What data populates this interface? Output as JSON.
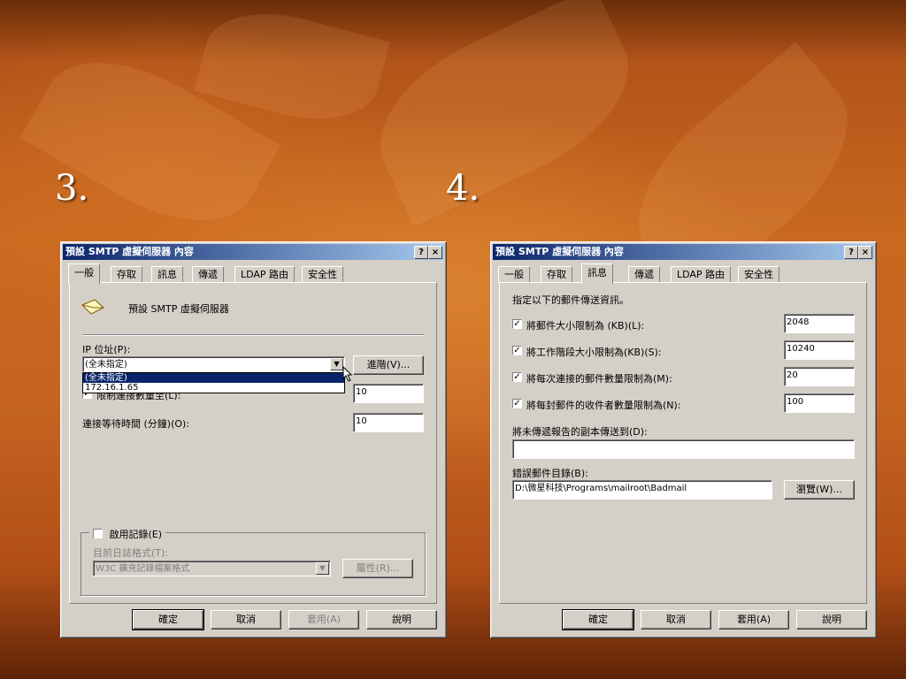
{
  "slide": {
    "num_left": "3.",
    "num_right": "4."
  },
  "common": {
    "title": "預設 SMTP 虛擬伺服器 內容",
    "help_glyph": "?",
    "close_glyph": "×",
    "tabs": [
      "一般",
      "存取",
      "訊息",
      "傳遞",
      "LDAP 路由",
      "安全性"
    ],
    "buttons": {
      "ok": "確定",
      "cancel": "取消",
      "apply": "套用(A)",
      "help": "說明"
    }
  },
  "left": {
    "server_name": "預設 SMTP 虛擬伺服器",
    "ip_label": "IP 位址(P):",
    "ip_selected": "(全未指定)",
    "ip_options": [
      "(全未指定)",
      "172.16.1.65"
    ],
    "advanced_button": "進階(V)...",
    "limit_label": "限制連接數量至(L):",
    "limit_value": "10",
    "timeout_label": "連接等待時間 (分鐘)(O):",
    "timeout_value": "10",
    "logging_label": "啟用記錄(E)",
    "log_format_label": "目前日誌格式(T):",
    "log_format_value": "W3C 擴充記錄檔案格式",
    "properties_button": "屬性(R)..."
  },
  "right": {
    "intro": "指定以下的郵件傳送資訊。",
    "limits": [
      {
        "label": "將郵件大小限制為 (KB)(L):",
        "value": "2048"
      },
      {
        "label": "將工作階段大小限制為(KB)(S):",
        "value": "10240"
      },
      {
        "label": "將每次連接的郵件數量限制為(M):",
        "value": "20"
      },
      {
        "label": "將每封郵件的收件者數量限制為(N):",
        "value": "100"
      }
    ],
    "ndr_label": "將未傳遞報告的副本傳送到(D):",
    "ndr_value": "",
    "badmail_label": "錯誤郵件目錄(B):",
    "badmail_value": "D:\\微星科技\\Programs\\mailroot\\Badmail",
    "browse_button": "瀏覽(W)..."
  }
}
